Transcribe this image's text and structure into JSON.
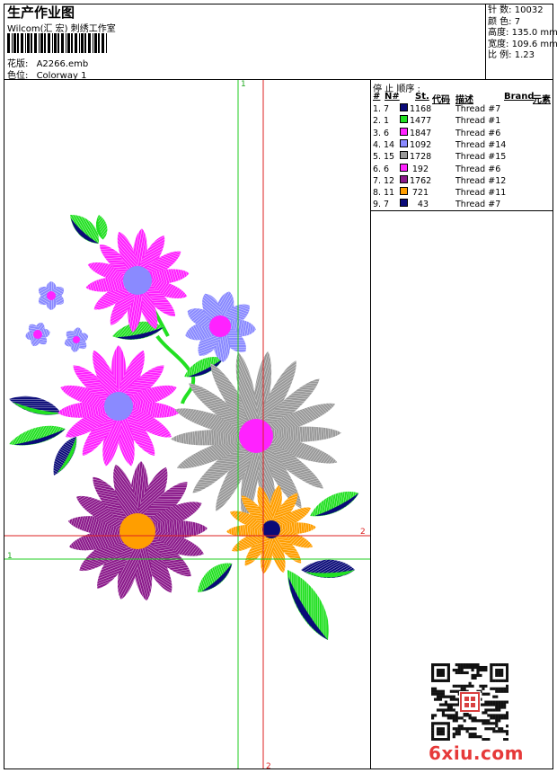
{
  "header": {
    "title": "生产作业图",
    "company": "Wilcom(汇 宏) 刺绣工作室",
    "pattern_label": "花版:",
    "pattern_value": "A2266.emb",
    "colorway_label": "色位:",
    "colorway_value": "Colorway 1"
  },
  "stats": [
    {
      "label": "针 数:",
      "value": "10032"
    },
    {
      "label": "颜 色:",
      "value": "7"
    },
    {
      "label": "高度:",
      "value": "135.0 mm"
    },
    {
      "label": "宽度:",
      "value": "109.6 mm"
    },
    {
      "label": "比 例:",
      "value": "1.23"
    }
  ],
  "sequence": {
    "title": "停 止 顺序 :",
    "columns": [
      "#",
      "N#",
      "St.",
      "代码",
      "描述",
      "Brand",
      "元素"
    ],
    "rows": [
      {
        "idx": "1.",
        "n": "7",
        "st": "1168",
        "desc": "Thread #7",
        "color": "#0a0a78"
      },
      {
        "idx": "2.",
        "n": "1",
        "st": "1477",
        "desc": "Thread #1",
        "color": "#22e022"
      },
      {
        "idx": "3.",
        "n": "6",
        "st": "1847",
        "desc": "Thread #6",
        "color": "#ff22ff"
      },
      {
        "idx": "4.",
        "n": "14",
        "st": "1092",
        "desc": "Thread #14",
        "color": "#8a8aff"
      },
      {
        "idx": "5.",
        "n": "15",
        "st": "1728",
        "desc": "Thread #15",
        "color": "#999999"
      },
      {
        "idx": "6.",
        "n": "6",
        "st": "192",
        "desc": "Thread #6",
        "color": "#ff22ff"
      },
      {
        "idx": "7.",
        "n": "12",
        "st": "1762",
        "desc": "Thread #12",
        "color": "#8b1a8b"
      },
      {
        "idx": "8.",
        "n": "11",
        "st": "721",
        "desc": "Thread #11",
        "color": "#ff9e00"
      },
      {
        "idx": "9.",
        "n": "7",
        "st": "43",
        "desc": "Thread #7",
        "color": "#0a0a78"
      }
    ]
  },
  "guides": {
    "green_label_1": "1",
    "green_label_2": "1",
    "red_label_1": "2",
    "red_label_2": "2"
  },
  "watermark": "6xiu.com"
}
